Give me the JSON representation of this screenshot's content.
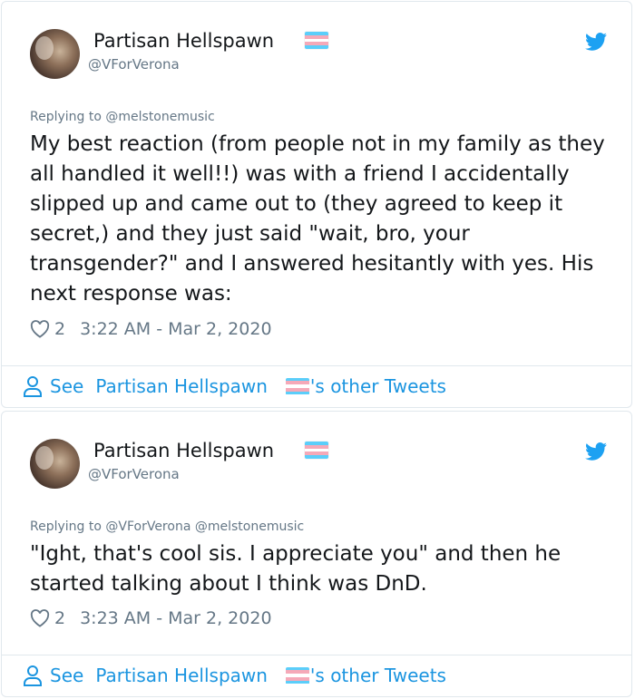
{
  "colors": {
    "twitter_blue": "#1b95e0",
    "text": "#14171a",
    "secondary": "#657786",
    "flag_blue": "#5bcefa",
    "flag_pink": "#f5a9b8",
    "flag_white": "#ffffff"
  },
  "tweets": [
    {
      "author_name": "Partisan Hellspawn",
      "author_handle": "@VForVerona",
      "replying_to": "Replying to @melstonemusic",
      "text": "My best reaction (from people not in my family as they all handled it well!!) was with a friend I accidentally slipped up and came out to (they agreed to keep it secret,) and they just said \"wait, bro, your transgender?\" and I answered hesitantly with yes. His next response was:",
      "likes": "2",
      "timestamp": "3:22 AM - Mar 2, 2020",
      "see_label": "See",
      "see_name": "Partisan Hellspawn",
      "see_suffix": "'s other Tweets"
    },
    {
      "author_name": "Partisan Hellspawn",
      "author_handle": "@VForVerona",
      "replying_to": "Replying to @VForVerona @melstonemusic",
      "text": "\"Ight, that's cool sis. I appreciate you\" and then he started talking about I think was DnD.",
      "likes": "2",
      "timestamp": "3:23 AM - Mar 2, 2020",
      "see_label": "See",
      "see_name": "Partisan Hellspawn",
      "see_suffix": "'s other Tweets"
    }
  ],
  "icons": {
    "avatar": "avatar-photo",
    "flag": "trans-flag-emoji",
    "brand": "twitter-bird-icon",
    "like": "heart-icon",
    "profile": "person-icon"
  }
}
